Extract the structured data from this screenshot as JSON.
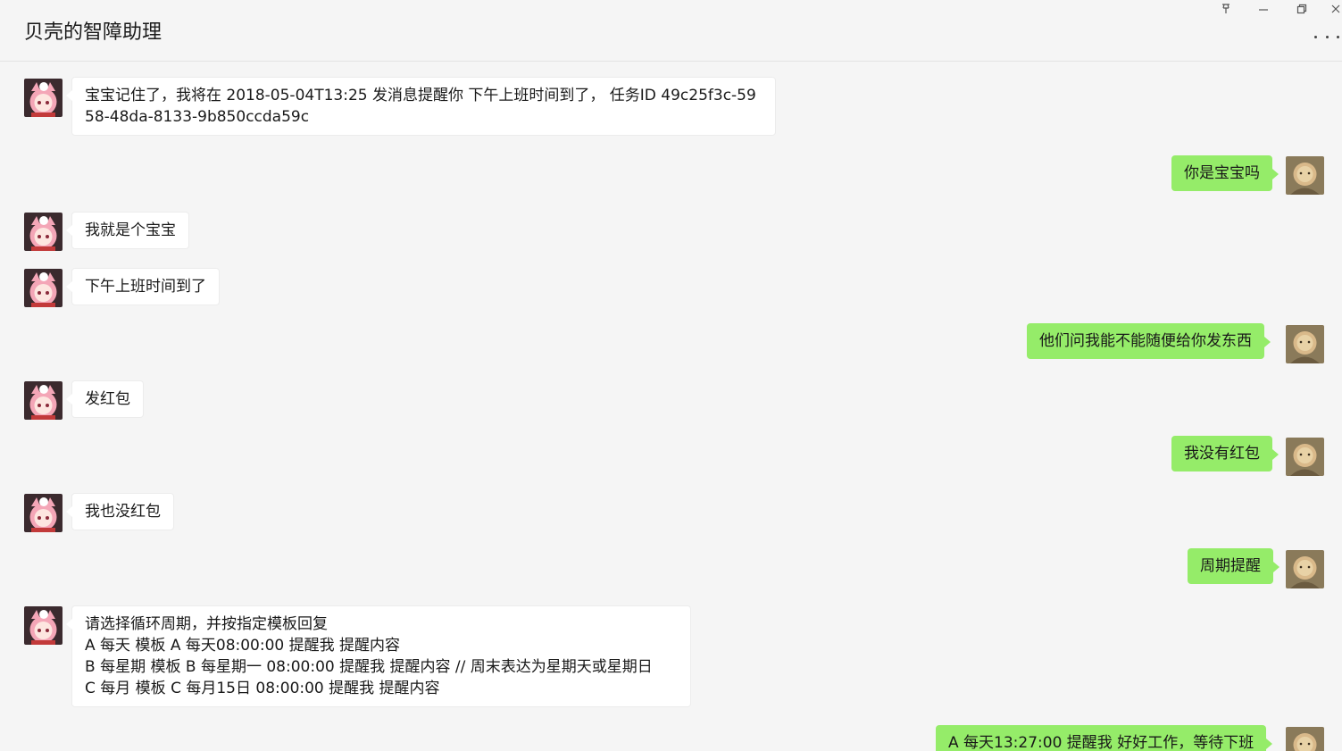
{
  "window": {
    "title": "贝壳的智障助理",
    "controls": [
      "pin-icon",
      "minimize-icon",
      "restore-icon",
      "close-icon"
    ],
    "more_icon": "more-dots-icon"
  },
  "colors": {
    "background": "#f5f5f5",
    "bubble_incoming": "#ffffff",
    "bubble_outgoing": "#95ec69"
  },
  "messages": [
    {
      "from": "assistant",
      "text": "宝宝记住了，我将在 2018-05-04T13:25 发消息提醒你 下午上班时间到了， 任务ID 49c25f3c-5958-48da-8133-9b850ccda59c"
    },
    {
      "from": "me",
      "text": "你是宝宝吗"
    },
    {
      "from": "assistant",
      "text": "我就是个宝宝"
    },
    {
      "from": "assistant",
      "text": "下午上班时间到了"
    },
    {
      "from": "me",
      "text": "他们问我能不能随便给你发东西"
    },
    {
      "from": "assistant",
      "text": "发红包"
    },
    {
      "from": "me",
      "text": "我没有红包"
    },
    {
      "from": "assistant",
      "text": "我也没红包"
    },
    {
      "from": "me",
      "text": "周期提醒"
    },
    {
      "from": "assistant",
      "text": "请选择循环周期，并按指定模板回复\nA 每天 模板 A 每天08:00:00 提醒我 提醒内容\nB 每星期 模板 B 每星期一 08:00:00 提醒我 提醒内容 // 周末表达为星期天或星期日\nC 每月 模板 C 每月15日 08:00:00 提醒我 提醒内容"
    },
    {
      "from": "me",
      "text": "A 每天13:27:00 提醒我 好好工作，等待下班"
    }
  ]
}
